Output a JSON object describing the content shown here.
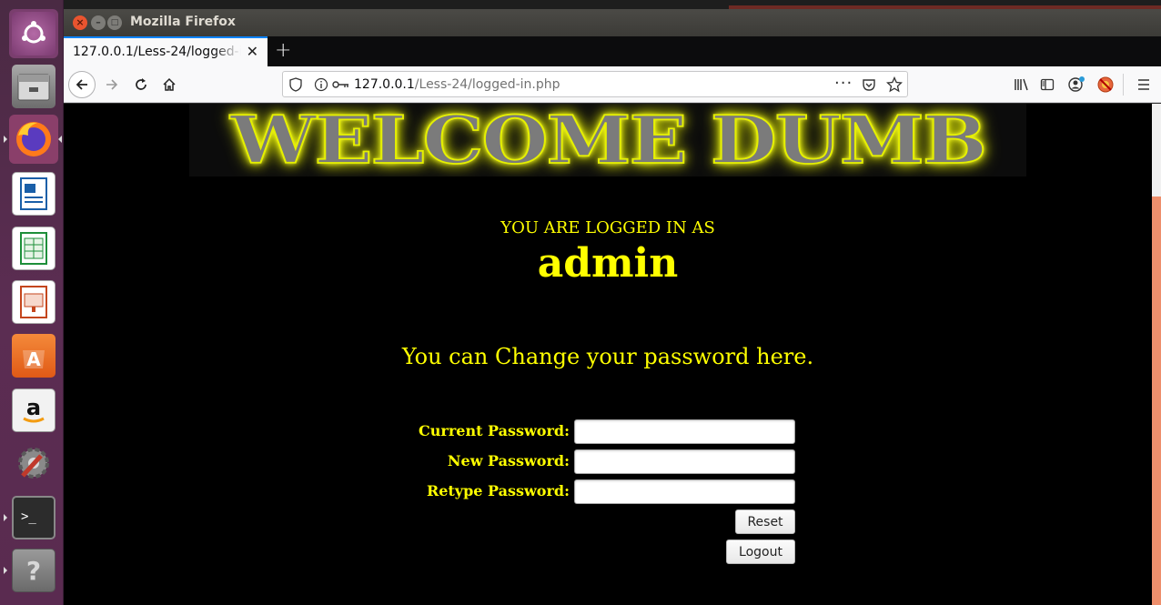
{
  "window": {
    "title": "Mozilla Firefox"
  },
  "tab": {
    "title": "127.0.0.1/Less-24/logged-in.php",
    "close_glyph": "✕"
  },
  "newtab_glyph": "+",
  "url": {
    "host": "127.0.0.1",
    "path": "/Less-24/logged-in.php"
  },
  "launcher": {
    "items": [
      "ubuntu-dash",
      "files",
      "firefox",
      "libreoffice-writer",
      "libreoffice-calc",
      "libreoffice-impress",
      "ubuntu-software",
      "amazon",
      "system-settings",
      "terminal",
      "help"
    ]
  },
  "page": {
    "banner": "WELCOME DUMB",
    "logged_in_as": "YOU ARE LOGGED IN AS",
    "username": "admin",
    "change_prompt": "You can Change your password here.",
    "form": {
      "current_label": "Current Password:",
      "new_label": "New Password:",
      "retype_label": "Retype Password:",
      "current_value": "",
      "new_value": "",
      "retype_value": "",
      "reset_label": "Reset",
      "logout_label": "Logout"
    }
  },
  "colors": {
    "page_bg": "#000000",
    "text_accent": "#ffff00",
    "launcher_bg": "#5b2d52",
    "firefox_tab_accent": "#0a84ff"
  }
}
